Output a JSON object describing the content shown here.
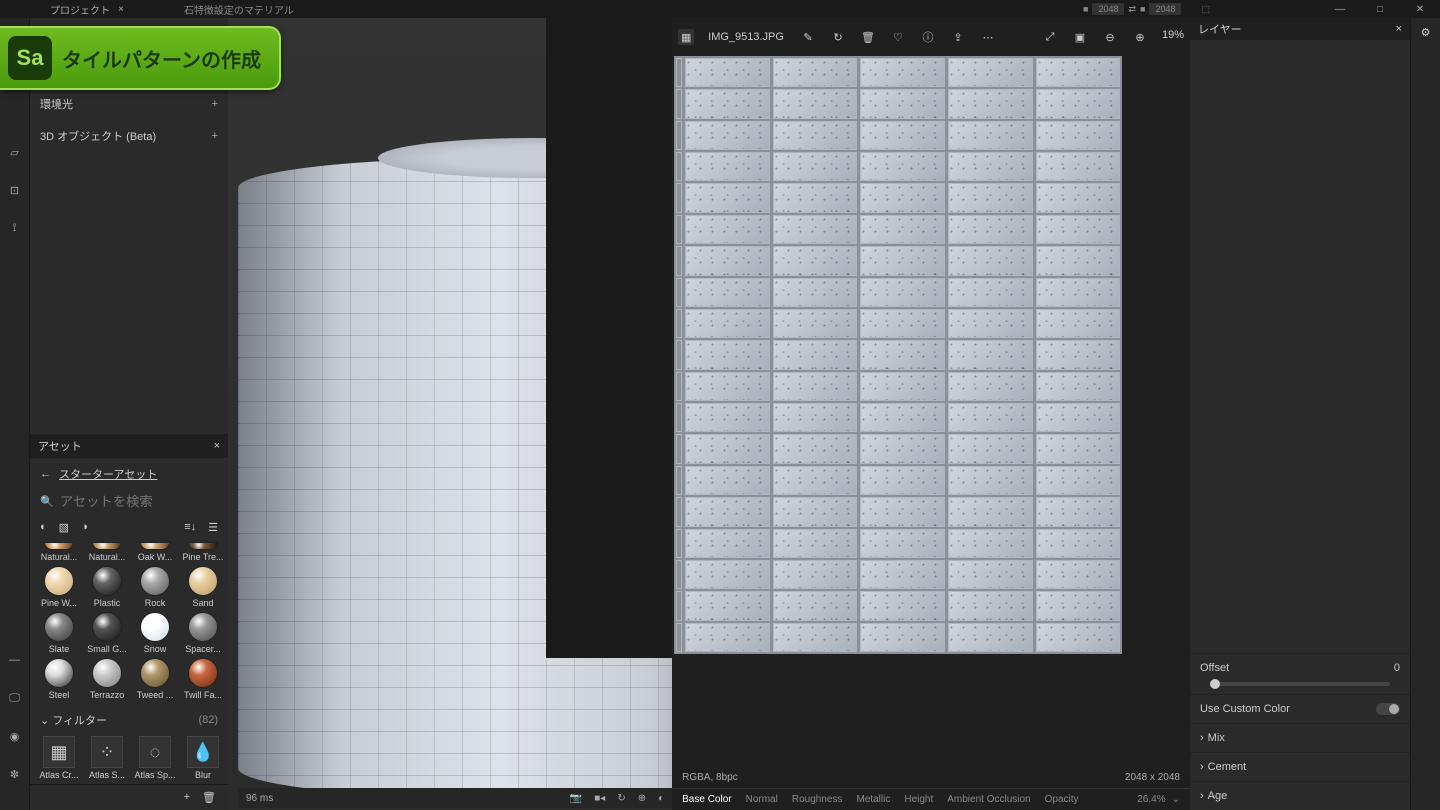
{
  "titlebar": {
    "project_label": "プロジェクト",
    "doc_tab": "石特徴設定のマテリアル"
  },
  "topright": {
    "v1": "2048",
    "v2": "2048"
  },
  "badge": {
    "logo": "Sa",
    "text": "タイルパターンの作成"
  },
  "left": {
    "env": "環境光",
    "obj3d": "3D オブジェクト (Beta)"
  },
  "assets": {
    "title": "アセット",
    "back": "スターターアセット",
    "search_placeholder": "アセットを検索",
    "count": "(82)",
    "filter_label": "フィルター",
    "materials_row1": [
      {
        "name": "Natural...",
        "c1": "#d4a26a",
        "c2": "#5a3b1a"
      },
      {
        "name": "Natural...",
        "c1": "#c9a070",
        "c2": "#4a3010"
      },
      {
        "name": "Oak W...",
        "c1": "#d0a878",
        "c2": "#6a4820"
      },
      {
        "name": "Pine Tre...",
        "c1": "#7a5a3a",
        "c2": "#2a1a0a"
      }
    ],
    "materials_row2": [
      {
        "name": "Pine W...",
        "c1": "#f0d8b0",
        "c2": "#c8a878"
      },
      {
        "name": "Plastic",
        "c1": "#666",
        "c2": "#111"
      },
      {
        "name": "Rock",
        "c1": "#aaa",
        "c2": "#555"
      },
      {
        "name": "Sand",
        "c1": "#e8d0a0",
        "c2": "#b89860"
      }
    ],
    "materials_row3": [
      {
        "name": "Slate",
        "c1": "#888",
        "c2": "#333"
      },
      {
        "name": "Small G...",
        "c1": "#555",
        "c2": "#111"
      },
      {
        "name": "Snow",
        "c1": "#fff",
        "c2": "#cde"
      },
      {
        "name": "Spacer...",
        "c1": "#999",
        "c2": "#444"
      }
    ],
    "materials_row4": [
      {
        "name": "Steel",
        "c1": "#ddd",
        "c2": "#222"
      },
      {
        "name": "Terrazzo",
        "c1": "#ccc",
        "c2": "#777"
      },
      {
        "name": "Tweed ...",
        "c1": "#b0986a",
        "c2": "#5a4a2a"
      },
      {
        "name": "Twill Fa...",
        "c1": "#c86840",
        "c2": "#6a2810"
      }
    ],
    "filters": [
      {
        "name": "Atlas Cr..."
      },
      {
        "name": "Atlas S..."
      },
      {
        "name": "Atlas Sp..."
      },
      {
        "name": "Blur"
      }
    ]
  },
  "vp3d": {
    "status": "96 ms"
  },
  "vp2d": {
    "filename": "IMG_9513.JPG",
    "zoom": "19%",
    "meta": "RGBA, 8bpc",
    "dims": "2048 x 2048",
    "channels": [
      "Base Color",
      "Normal",
      "Roughness",
      "Metallic",
      "Height",
      "Ambient Occlusion",
      "Opacity"
    ],
    "channel_pct": "26.4%"
  },
  "right": {
    "title": "レイヤー",
    "offset_label": "Offset",
    "offset_val": "0",
    "usecolor": "Use Custom Color",
    "acc": [
      "Mix",
      "Cement",
      "Age"
    ]
  }
}
